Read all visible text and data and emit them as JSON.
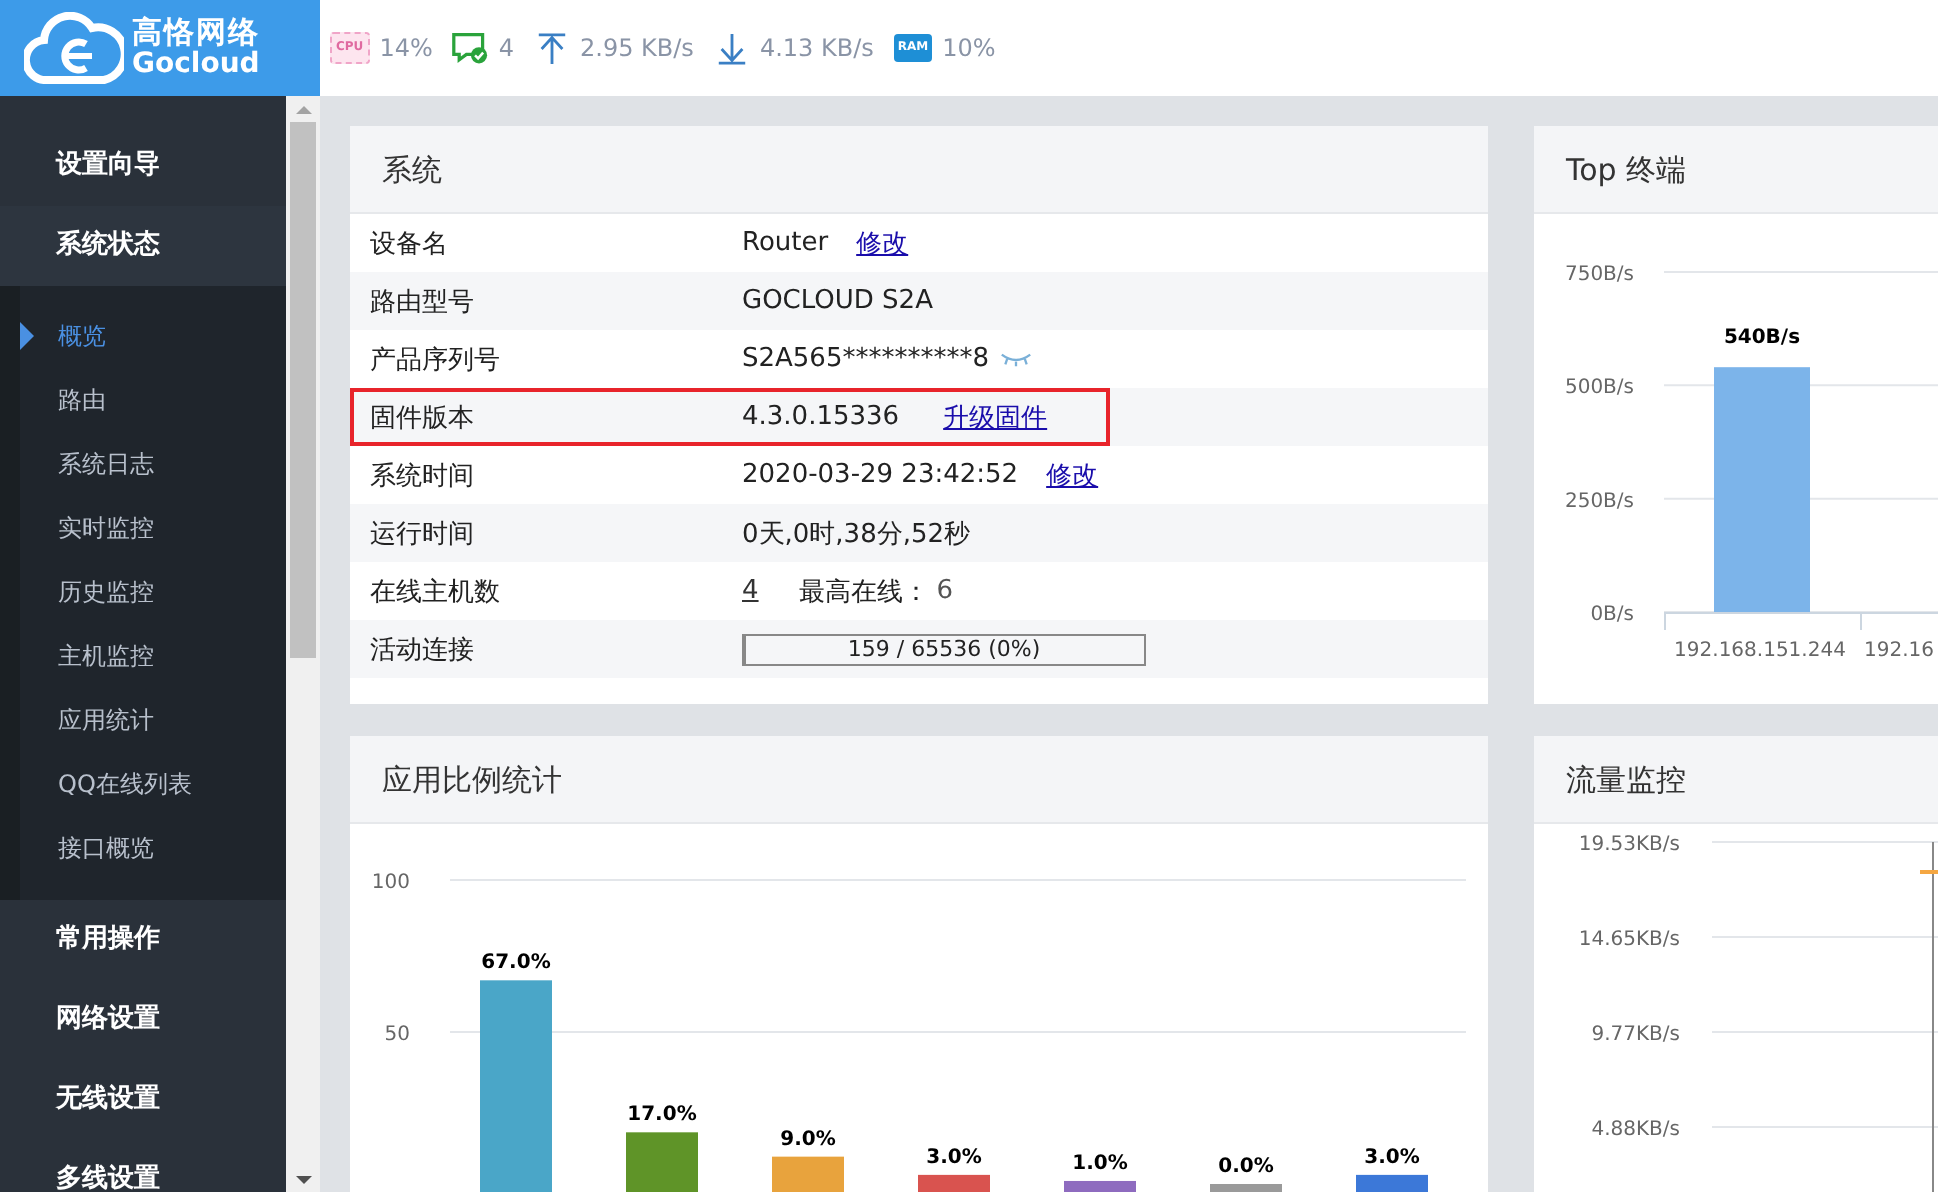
{
  "logo": {
    "name": "高恪网络",
    "sub": "Gocloud"
  },
  "status_bar": [
    {
      "kind": "cpu",
      "icon_label": "CPU",
      "value": "14%"
    },
    {
      "kind": "hosts",
      "value": "4"
    },
    {
      "kind": "upload",
      "value": "2.95 KB/s"
    },
    {
      "kind": "download",
      "value": "4.13 KB/s"
    },
    {
      "kind": "ram",
      "icon_label": "RAM",
      "value": "10%"
    }
  ],
  "sidebar": {
    "items": [
      {
        "label": "设置向导"
      },
      {
        "label": "系统状态",
        "expanded": true,
        "children": [
          {
            "label": "概览",
            "selected": true
          },
          {
            "label": "路由",
            "selected": false
          },
          {
            "label": "系统日志",
            "selected": false
          },
          {
            "label": "实时监控",
            "selected": false
          },
          {
            "label": "历史监控",
            "selected": false
          },
          {
            "label": "主机监控",
            "selected": false
          },
          {
            "label": "应用统计",
            "selected": false
          },
          {
            "label": "QQ在线列表",
            "selected": false
          },
          {
            "label": "接口概览",
            "selected": false
          }
        ]
      },
      {
        "label": "常用操作"
      },
      {
        "label": "网络设置"
      },
      {
        "label": "无线设置"
      },
      {
        "label": "多线设置"
      }
    ]
  },
  "system": {
    "title": "系统",
    "rows": [
      {
        "kind": "text",
        "label": "设备名",
        "value": "Router",
        "link": "修改",
        "highlight": false
      },
      {
        "kind": "text",
        "label": "路由型号",
        "value": "GOCLOUD S2A",
        "highlight": false
      },
      {
        "kind": "secret",
        "label": "产品序列号",
        "value": "S2A565**********8",
        "highlight": false
      },
      {
        "kind": "text",
        "label": "固件版本",
        "value": "4.3.0.15336",
        "link": "升级固件",
        "highlight": true
      },
      {
        "kind": "text",
        "label": "系统时间",
        "value": "2020-03-29 23:42:52",
        "link": "修改",
        "highlight": false
      },
      {
        "kind": "text",
        "label": "运行时间",
        "value": "0天,0时,38分,52秒",
        "highlight": false
      },
      {
        "kind": "hosts",
        "label": "在线主机数",
        "value": "4",
        "extra_label": "最高在线：",
        "extra_value": "6",
        "highlight": false
      },
      {
        "kind": "progress",
        "label": "活动连接",
        "value": "159 / 65536 (0%)",
        "level": 0,
        "highlight": false
      }
    ]
  },
  "top_terminals": {
    "title": "Top 终端",
    "chart_data": {
      "type": "bar",
      "categories": [
        "192.168.151.244",
        "192.16"
      ],
      "series": [
        {
          "color": "#7cb4ea",
          "values": [
            540,
            null
          ]
        }
      ],
      "ylim": [
        0,
        750
      ],
      "yticks": [
        {
          "value": 0,
          "label": "0B/s"
        },
        {
          "value": 250,
          "label": "250B/s"
        },
        {
          "value": 500,
          "label": "500B/s"
        },
        {
          "value": 750,
          "label": "750B/s"
        }
      ],
      "value_labels": [
        "540B/s",
        null
      ]
    }
  },
  "app_stats": {
    "title": "应用比例统计",
    "chart_data": {
      "type": "bar",
      "categories": [
        null,
        null,
        null,
        null,
        null,
        null,
        null
      ],
      "series": [
        {
          "values": [
            67,
            17,
            9,
            3,
            1,
            0,
            3
          ]
        }
      ],
      "colors": [
        "#4aa6c8",
        "#5f9428",
        "#e8a33d",
        "#d9534f",
        "#8e6bbf",
        "#9a9a9a",
        "#3c78d8"
      ],
      "ylim": [
        0,
        100
      ],
      "yticks": [
        50,
        100
      ],
      "value_labels": [
        "67.0%",
        "17.0%",
        "9.0%",
        "3.0%",
        "1.0%",
        "0.0%",
        "3.0%"
      ]
    }
  },
  "traffic": {
    "title": "流量监控",
    "axis_labels": [
      "19.53KB/s",
      "14.65KB/s",
      "9.77KB/s",
      "4.88KB/s"
    ]
  }
}
